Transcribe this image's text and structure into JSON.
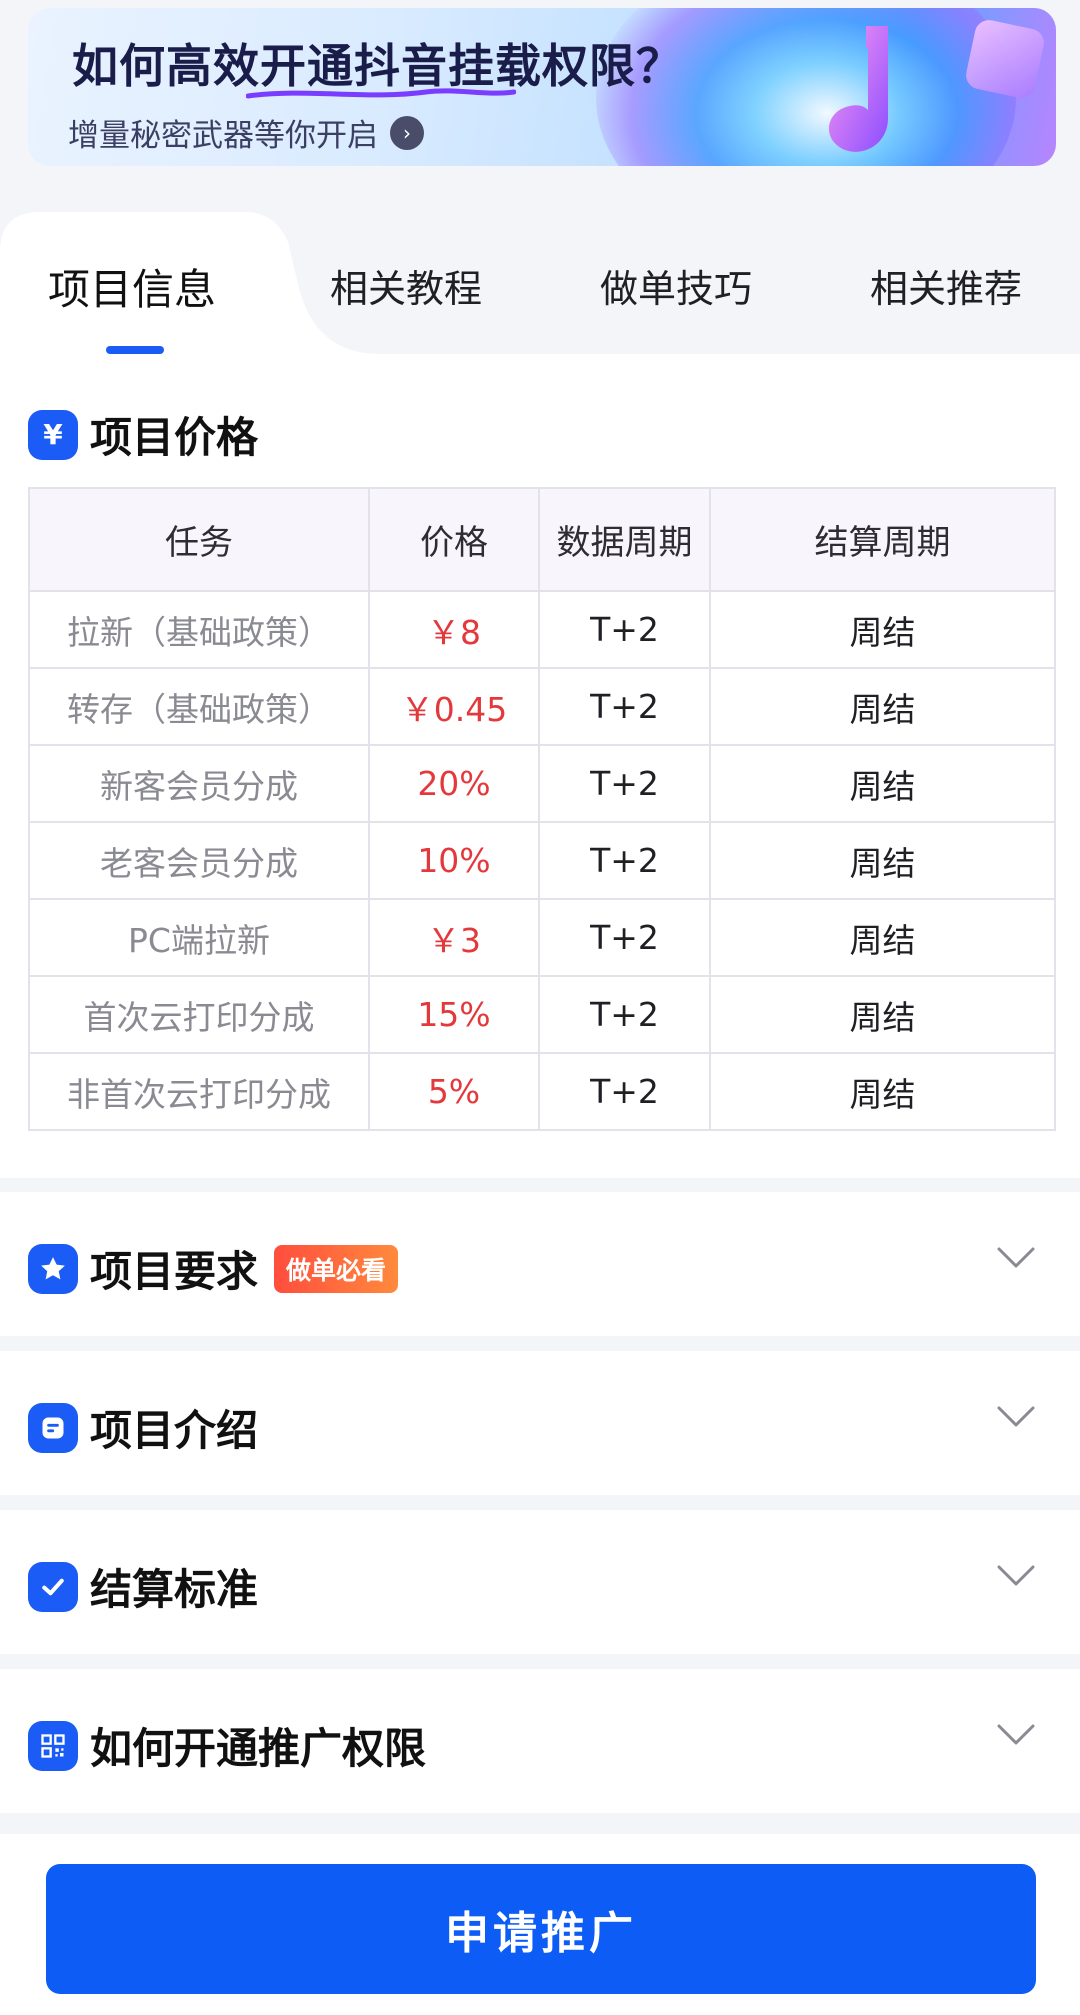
{
  "banner": {
    "title": "如何高效开通抖音挂载权限？",
    "subtitle": "增量秘密武器等你开启"
  },
  "tabs": [
    {
      "label": "项目信息",
      "active": true
    },
    {
      "label": "相关教程",
      "active": false
    },
    {
      "label": "做单技巧",
      "active": false
    },
    {
      "label": "相关推荐",
      "active": false
    }
  ],
  "price_section": {
    "icon": "yen-icon",
    "title": "项目价格",
    "headers": [
      "任务",
      "价格",
      "数据周期",
      "结算周期"
    ],
    "rows": [
      {
        "task": "拉新（基础政策）",
        "price": "￥8",
        "data_cycle": "T+2",
        "settle_cycle": "周结"
      },
      {
        "task": "转存（基础政策）",
        "price": "￥0.45",
        "data_cycle": "T+2",
        "settle_cycle": "周结"
      },
      {
        "task": "新客会员分成",
        "price": "20%",
        "data_cycle": "T+2",
        "settle_cycle": "周结"
      },
      {
        "task": "老客会员分成",
        "price": "10%",
        "data_cycle": "T+2",
        "settle_cycle": "周结"
      },
      {
        "task": "PC端拉新",
        "price": "￥3",
        "data_cycle": "T+2",
        "settle_cycle": "周结"
      },
      {
        "task": "首次云打印分成",
        "price": "15%",
        "data_cycle": "T+2",
        "settle_cycle": "周结"
      },
      {
        "task": "非首次云打印分成",
        "price": "5%",
        "data_cycle": "T+2",
        "settle_cycle": "周结"
      }
    ]
  },
  "sections": [
    {
      "title": "项目要求",
      "icon": "star-icon",
      "badge": "做单必看"
    },
    {
      "title": "项目介绍",
      "icon": "document-icon"
    },
    {
      "title": "结算标准",
      "icon": "check-icon"
    },
    {
      "title": "如何开通推广权限",
      "icon": "qr-code-icon"
    }
  ],
  "bottom": {
    "apply_label": "申请推广"
  },
  "colors": {
    "accent": "#1a5cf5",
    "price_red": "#e4393c",
    "button": "#0d5cf5"
  }
}
